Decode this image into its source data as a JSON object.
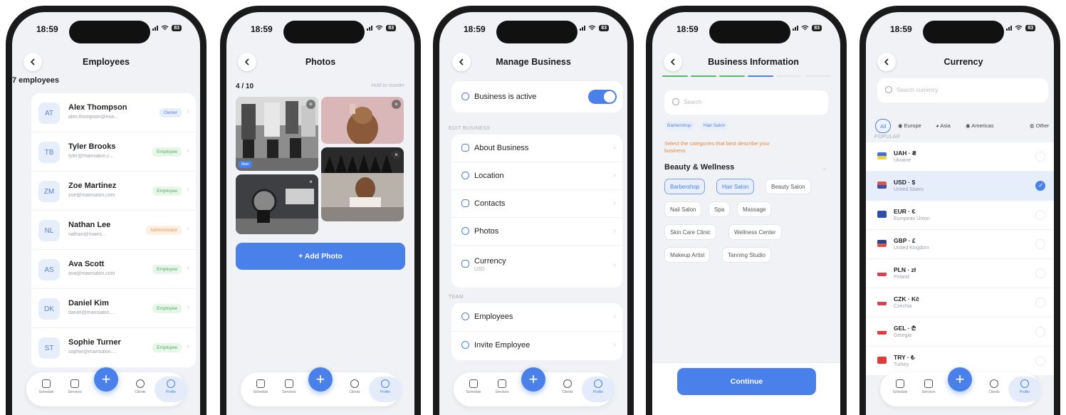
{
  "status": {
    "time": "18:59",
    "battery": "83"
  },
  "tabbar": {
    "schedule": "Schedule",
    "services": "Services",
    "clients": "Clients",
    "profile": "Profile",
    "add": "+"
  },
  "employees": {
    "title": "Employees",
    "count": "7 employees",
    "rows": [
      {
        "initials": "AT",
        "name": "Alex Thompson",
        "email": "alex.thompson@exa...",
        "role": "Owner",
        "kind": "owner"
      },
      {
        "initials": "TB",
        "name": "Tyler Brooks",
        "email": "tyler@mainsalon.c...",
        "role": "Employee",
        "kind": "employee"
      },
      {
        "initials": "ZM",
        "name": "Zoe Martinez",
        "email": "zoe@mainsalon.com",
        "role": "Employee",
        "kind": "employee"
      },
      {
        "initials": "NL",
        "name": "Nathan Lee",
        "email": "nathan@mains...",
        "role": "Administrator",
        "kind": "admin"
      },
      {
        "initials": "AS",
        "name": "Ava Scott",
        "email": "ava@mainsalon.com",
        "role": "Employee",
        "kind": "employee"
      },
      {
        "initials": "DK",
        "name": "Daniel Kim",
        "email": "daniel@mainsalon....",
        "role": "Employee",
        "kind": "employee"
      },
      {
        "initials": "ST",
        "name": "Sophie Turner",
        "email": "sophie@mainsalon....",
        "role": "Employee",
        "kind": "employee"
      }
    ]
  },
  "photos": {
    "title": "Photos",
    "count": "4 / 10",
    "hint": "Hold to reorder",
    "main_badge": "Main",
    "add_button": "+ Add Photo"
  },
  "manage": {
    "title": "Manage Business",
    "active_label": "Business is active",
    "section_edit": "EDIT BUSINESS",
    "section_team": "TEAM",
    "items": [
      {
        "label": "About Business"
      },
      {
        "label": "Location"
      },
      {
        "label": "Contacts"
      },
      {
        "label": "Photos"
      },
      {
        "label": "Currency",
        "sub": "USD"
      }
    ],
    "team": [
      {
        "label": "Employees"
      },
      {
        "label": "Invite Employee"
      }
    ]
  },
  "business_info": {
    "title": "Business Information",
    "search_placeholder": "Search",
    "selected": [
      "Barbershop",
      "Hair Salon"
    ],
    "hint": "Select the categories that best describe your business",
    "category": "Beauty & Wellness",
    "chips": [
      "Barbershop",
      "Hair Salon",
      "Beauty Salon",
      "Nail Salon",
      "Spa",
      "Massage",
      "Skin Care Clinic",
      "Wellness Center",
      "Makeup Artist",
      "Tanning Studio"
    ],
    "continue": "Continue"
  },
  "currency": {
    "title": "Currency",
    "search_placeholder": "Search currency",
    "filters": [
      "All",
      "Europe",
      "Asia",
      "Americas",
      "Other"
    ],
    "popular": "POPULAR",
    "rows": [
      {
        "code": "UAH · ₴",
        "name": "Ukraine",
        "flag": "#3d6fd6",
        "flag2": "#f2cf3a",
        "selected": false
      },
      {
        "code": "USD · $",
        "name": "United States",
        "flag": "#d9534f",
        "flag2": "#3a4fa3",
        "selected": true
      },
      {
        "code": "EUR · €",
        "name": "European Union",
        "flag": "#2f4ea8",
        "flag2": "#2f4ea8",
        "selected": false
      },
      {
        "code": "GBP · £",
        "name": "United Kingdom",
        "flag": "#2b3f8f",
        "flag2": "#d9534f",
        "selected": false
      },
      {
        "code": "PLN · zł",
        "name": "Poland",
        "flag": "#ffffff",
        "flag2": "#d94050",
        "selected": false
      },
      {
        "code": "CZK · Kč",
        "name": "Czechia",
        "flag": "#ffffff",
        "flag2": "#d94050",
        "selected": false
      },
      {
        "code": "GEL · ₾",
        "name": "Georgia",
        "flag": "#ffffff",
        "flag2": "#e03a3a",
        "selected": false
      },
      {
        "code": "TRY · ₺",
        "name": "Turkey",
        "flag": "#e03a3a",
        "flag2": "#e03a3a",
        "selected": false
      }
    ]
  }
}
